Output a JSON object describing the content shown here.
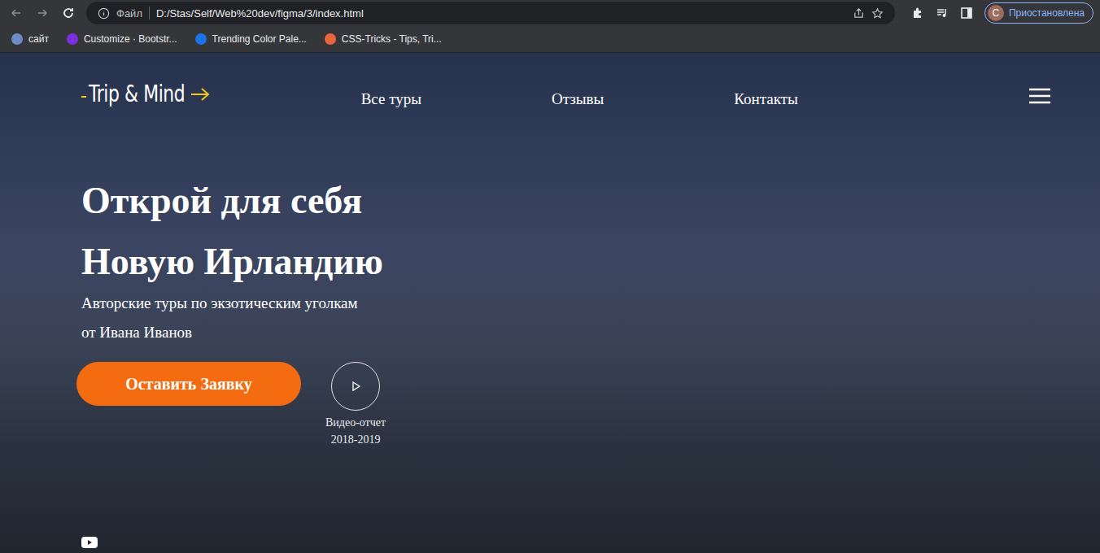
{
  "browser": {
    "address_prefix": "Файл",
    "url": "D:/Stas/Self/Web%20dev/figma/3/index.html",
    "profile_initial": "С",
    "profile_status": "Приостановлена"
  },
  "bookmarks": [
    {
      "label": "сайт",
      "color": "#6d8cc7"
    },
    {
      "label": "Customize · Bootstr...",
      "color": "#7b2fe0"
    },
    {
      "label": "Trending Color Pale...",
      "color": "#1a73e8"
    },
    {
      "label": "CSS-Tricks - Tips, Tri...",
      "color": "#e8663a"
    }
  ],
  "page": {
    "logo": "Trip & Mind",
    "nav": [
      "Все туры",
      "Отзывы",
      "Контакты"
    ],
    "title_lines": [
      "Открой для себя",
      "Новую Ирландию"
    ],
    "subtitle_lines": [
      "Авторские туры по экзотическим уголкам",
      "от Ивана Иванов"
    ],
    "cta": "Оставить Заявку",
    "video_lines": [
      "Видео-отчет",
      "2018-2019"
    ]
  }
}
